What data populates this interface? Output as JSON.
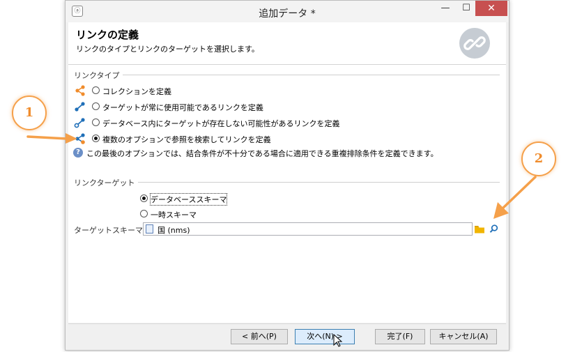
{
  "window": {
    "title": "追加データ *",
    "controls": {
      "minimize": "—",
      "maximize": "☐",
      "close": "✕"
    }
  },
  "header": {
    "title": "リンクの定義",
    "subtitle": "リンクのタイプとリンクのターゲットを選択します。",
    "icon": "link-icon"
  },
  "link_type": {
    "label": "リンクタイプ",
    "options": [
      {
        "label": "コレクションを定義",
        "icon": "collection-link-icon",
        "selected": false
      },
      {
        "label": "ターゲットが常に使用可能であるリンクを定義",
        "icon": "simple-link-icon",
        "selected": false
      },
      {
        "label": "データベース内にターゲットが存在しない可能性があるリンクを定義",
        "icon": "optional-link-icon",
        "selected": false
      },
      {
        "label": "複数のオプションで参照を検索してリンクを定義",
        "icon": "multi-option-link-icon",
        "selected": true
      }
    ],
    "info": "この最後のオプションでは、結合条件が不十分である場合に適用できる重複排除条件を定義できます。"
  },
  "link_target": {
    "label": "リンクターゲット",
    "options": [
      {
        "label": "データベーススキーマ",
        "selected": true
      },
      {
        "label": "一時スキーマ",
        "selected": false
      }
    ],
    "schema_label": "ターゲットスキーマ:",
    "schema_value": "国 (nms)"
  },
  "buttons": {
    "back": "< 前へ(P)",
    "next": "次へ(N) >",
    "finish": "完了(F)",
    "cancel": "キャンセル(A)"
  },
  "callouts": [
    "1",
    "2"
  ],
  "colors": {
    "accent": "#f5a04a",
    "link_icon_blue": "#1f6fb8",
    "close": "#c75050"
  }
}
